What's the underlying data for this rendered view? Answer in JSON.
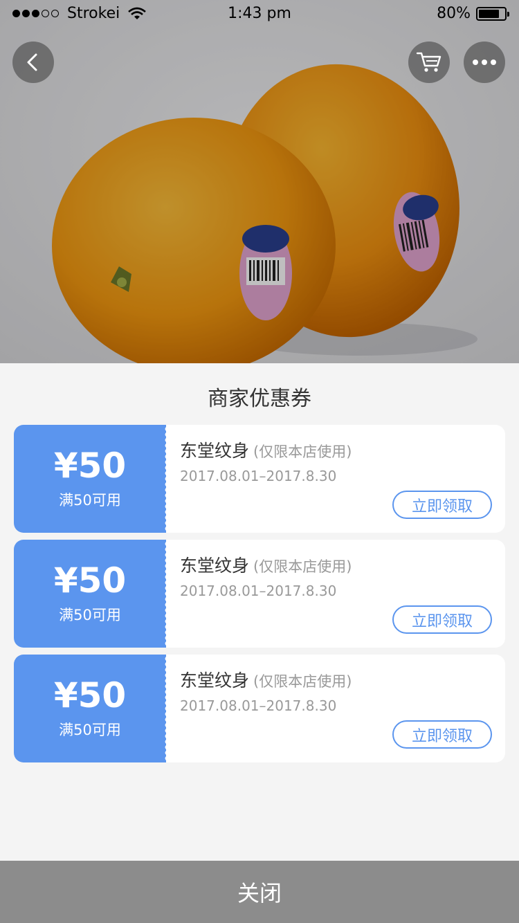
{
  "status_bar": {
    "carrier": "Strokei",
    "time": "1:43 pm",
    "battery": "80%",
    "battery_level": 0.8
  },
  "hero": {
    "image": "oranges-photo"
  },
  "top_buttons": {
    "back_icon": "chevron-left-icon",
    "cart_icon": "cart-icon",
    "more_icon": "more-icon"
  },
  "sheet": {
    "title": "商家优惠券",
    "coupons": [
      {
        "amount": "¥50",
        "condition": "满50可用",
        "shop": "东堂纹身",
        "note": "(仅限本店使用)",
        "date": "2017.08.01–2017.8.30",
        "action": "立即领取"
      },
      {
        "amount": "¥50",
        "condition": "满50可用",
        "shop": "东堂纹身",
        "note": "(仅限本店使用)",
        "date": "2017.08.01–2017.8.30",
        "action": "立即领取"
      },
      {
        "amount": "¥50",
        "condition": "满50可用",
        "shop": "东堂纹身",
        "note": "(仅限本店使用)",
        "date": "2017.08.01–2017.8.30",
        "action": "立即领取"
      }
    ]
  },
  "footer": {
    "close_label": "关闭"
  },
  "colors": {
    "accent": "#5b95ee",
    "close_bar": "#8c8c8c",
    "sheet_bg": "#f4f4f4"
  }
}
